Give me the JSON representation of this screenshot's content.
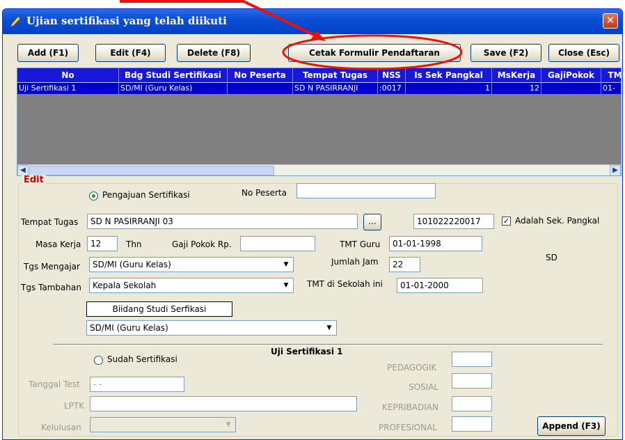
{
  "window": {
    "title": "Ujian sertifikasi yang telah diikuti",
    "close_glyph": "✕"
  },
  "toolbar": {
    "add_label": "Add (F1)",
    "edit_label": "Edit (F4)",
    "delete_label": "Delete (F8)",
    "cetak_label": "Cetak Formulir Pendaftaran",
    "save_label": "Save (F2)",
    "close_label": "Close (Esc)"
  },
  "grid": {
    "columns": [
      "No",
      "Bdg Studi Sertifikasi",
      "No Peserta",
      "Tempat Tugas",
      "NSS",
      "Is Sek Pangkal",
      "MsKerja",
      "GajiPokok",
      "TM"
    ],
    "row": [
      "Uji Sertifikasi 1",
      "SD/MI (Guru Kelas)",
      "",
      "SD N PASIRRANJI",
      ":0017",
      "1",
      "12",
      "",
      "01-"
    ]
  },
  "edit": {
    "legend": "Edit",
    "pengajuan_label": "Pengajuan Sertifikasi",
    "no_peserta_label": "No Peserta",
    "no_peserta_value": "",
    "tempat_tugas_label": "Tempat Tugas",
    "tempat_tugas_value": "SD N PASIRRANJI 03",
    "browse_label": "...",
    "nss_value": "101022220017",
    "adalah_sek_label": "Adalah Sek. Pangkal",
    "adalah_sek_check": "✓",
    "masa_kerja_label": "Masa Kerja",
    "masa_kerja_value": "12",
    "thn_label": "Thn",
    "gaji_label": "Gaji Pokok Rp.",
    "gaji_value": "",
    "tmt_guru_label": "TMT Guru",
    "tmt_guru_value": "01-01-1998",
    "tgs_mengajar_label": "Tgs Mengajar",
    "tgs_mengajar_value": "SD/MI (Guru Kelas)",
    "jumlah_jam_label": "Jumlah Jam",
    "jumlah_jam_value": "22",
    "sd_label": "SD",
    "tgs_tambahan_label": "Tgs Tambahan",
    "tgs_tambahan_value": "Kepala Sekolah",
    "tmt_sekolah_label": "TMT di Sekolah ini",
    "tmt_sekolah_value": "01-01-2000",
    "bidang_label": "Biidang Studi Serfikasi",
    "bidang_value": "SD/MI (Guru Kelas)",
    "dropdown_glyph": "▼",
    "sudah_label": "Sudah Sertifikasi",
    "uji_title": "Uji Sertifikasi 1",
    "tanggal_test_label": "Tanggal Test",
    "tanggal_test_value": " - -",
    "lptk_label": "LPTK",
    "lptk_value": "",
    "kelulusan_label": "Kelulusan",
    "kelulusan_value": "",
    "pedagogik_label": "PEDAGOGIK",
    "sosial_label": "SOSIAL",
    "kepribadian_label": "KEPRIBADIAN",
    "profesional_label": "PROFESIONAL",
    "append_label": "Append (F3)"
  },
  "annotation": {
    "color": "#e8140c"
  },
  "scroll": {
    "left_glyph": "◀",
    "right_glyph": "▶"
  }
}
